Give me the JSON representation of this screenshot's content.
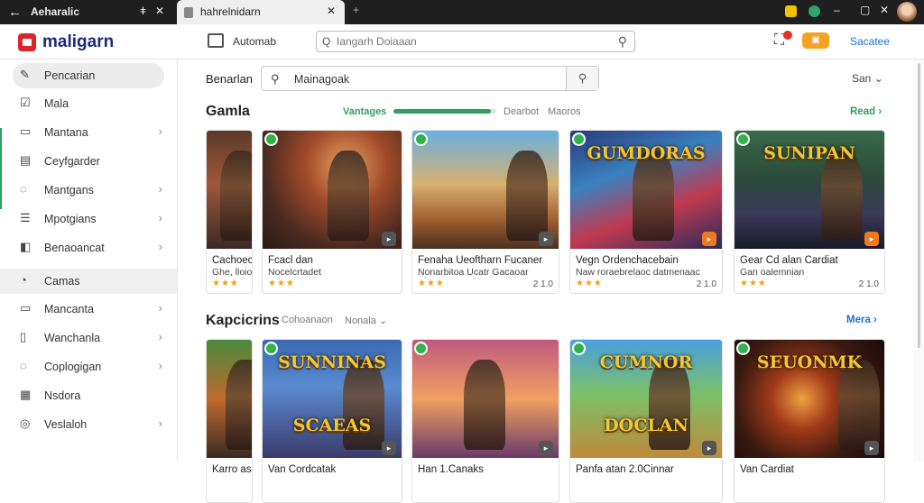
{
  "browser": {
    "tab1_title": "Aeharalic",
    "tab2_title": "hahrelnidarn"
  },
  "header": {
    "logo_text": "maligarn",
    "workspace_label": "Automab",
    "search_placeholder": "Iangarh Doiaaan",
    "notif_label": "▣",
    "link_label": "Sacatee"
  },
  "sidebar": {
    "items": [
      {
        "icon": "pencil-icon",
        "label": "Pencarian",
        "chevron": false,
        "active": true
      },
      {
        "icon": "checkbox-icon",
        "label": "Mala",
        "chevron": false
      },
      {
        "icon": "monitor-icon",
        "label": "Mantana",
        "chevron": true
      },
      {
        "icon": "card-icon",
        "label": "Ceyfgarder",
        "chevron": false
      },
      {
        "icon": "chat-icon",
        "label": "Mantgans",
        "chevron": true
      },
      {
        "icon": "list-icon",
        "label": "Mpotgians",
        "chevron": true
      },
      {
        "icon": "bag-icon",
        "label": "Benaoancat",
        "chevron": true
      },
      {
        "icon": "gamepad-icon",
        "label": "Camas",
        "chevron": false,
        "section": true
      },
      {
        "icon": "monitor-icon",
        "label": "Mancanta",
        "chevron": true
      },
      {
        "icon": "doc-icon",
        "label": "Wanchanla",
        "chevron": true
      },
      {
        "icon": "chat-icon",
        "label": "Coplogigan",
        "chevron": true
      },
      {
        "icon": "grid-icon",
        "label": "Nsdora",
        "chevron": false
      },
      {
        "icon": "bell-icon",
        "label": "Veslaloh",
        "chevron": true
      }
    ]
  },
  "main": {
    "search_label": "Benarlan",
    "search_value": "Mainagoak",
    "sort_label": "San"
  },
  "section1": {
    "title": "Gamla",
    "pills": [
      "Vantages",
      "Dearbot",
      "Maoros"
    ],
    "progress": 0.95,
    "more_label": "Read"
  },
  "section2": {
    "title": "Kapcicrins",
    "pills": [
      "Cohoanaon",
      "Nonala"
    ],
    "more_label": "Mera"
  },
  "row1_cards": [
    {
      "title": "Cachoec",
      "sub": "Ghe, lloiodo",
      "stars": "★★★",
      "meta": ""
    },
    {
      "title": "Fcacl dan",
      "sub": "Nocelcrtadet",
      "stars": "★★★",
      "meta": ""
    },
    {
      "title": "Fenaha Ueoftharn Fucaner",
      "sub": "Nonarbitoa Ucatr Gacaoar",
      "stars": "★★★",
      "meta": "2 1.0"
    },
    {
      "title": "Vegn Ordenchacebain",
      "sub": "Naw roraebrelaoc datmenaac",
      "stars": "★★★",
      "meta": "2 1.0"
    },
    {
      "title": "Gear Cd alan Cardiat",
      "sub": "Gan oalemnian",
      "stars": "★★★",
      "meta": "2 1.0"
    }
  ],
  "row1_art_text": [
    "",
    "",
    "",
    "GUMDORAS",
    "SUNIPAN"
  ],
  "row2_cards": [
    {
      "title": "Karro as",
      "sub": ""
    },
    {
      "title": "Van Cordcatak",
      "sub": ""
    },
    {
      "title": "Han 1.Canaks",
      "sub": ""
    },
    {
      "title": "Panfa atan 2.0Cinnar",
      "sub": ""
    },
    {
      "title": "Van Cardiat",
      "sub": ""
    }
  ],
  "row2_art_text": [
    "",
    "SUNNINAS",
    "",
    "CUMNOR",
    "SEUONMK"
  ],
  "row2_art_text2": [
    "",
    "SCAEAS",
    "",
    "DOCLAN",
    ""
  ]
}
